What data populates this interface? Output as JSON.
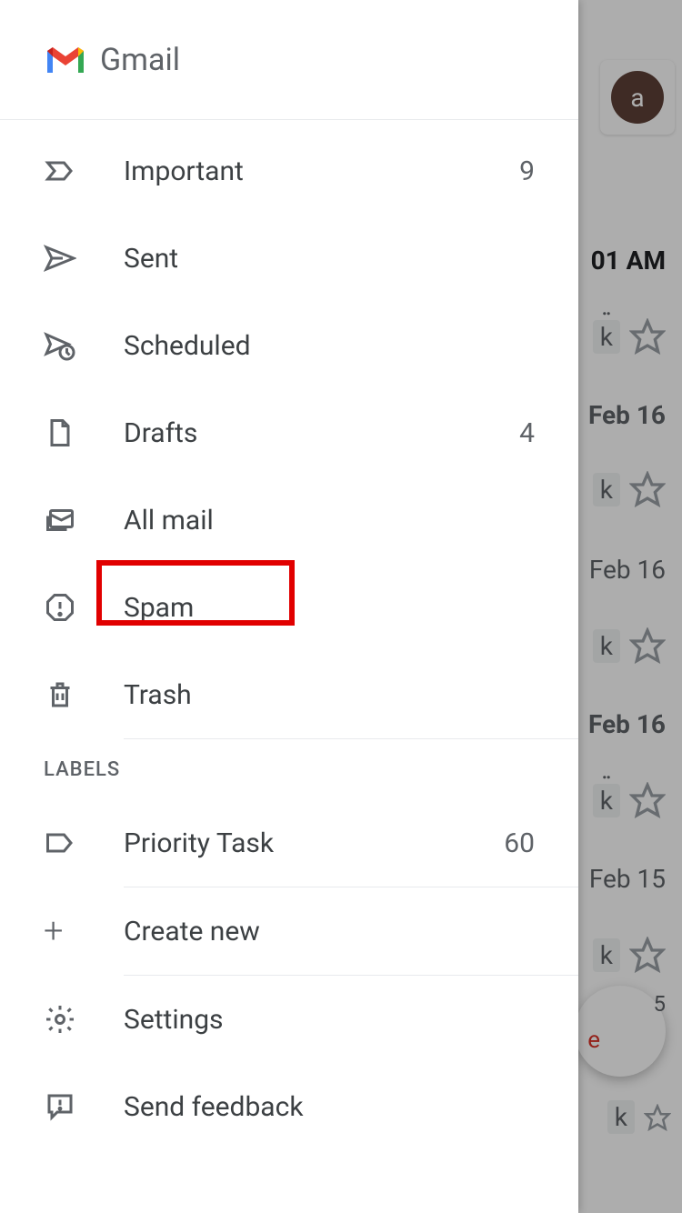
{
  "header": {
    "app_name": "Gmail"
  },
  "nav": {
    "items": [
      {
        "icon": "important",
        "label": "Important",
        "count": "9"
      },
      {
        "icon": "sent",
        "label": "Sent",
        "count": ""
      },
      {
        "icon": "scheduled",
        "label": "Scheduled",
        "count": ""
      },
      {
        "icon": "drafts",
        "label": "Drafts",
        "count": "4"
      },
      {
        "icon": "all-mail",
        "label": "All mail",
        "count": ""
      },
      {
        "icon": "spam",
        "label": "Spam",
        "count": ""
      },
      {
        "icon": "trash",
        "label": "Trash",
        "count": ""
      }
    ],
    "labels_header": "LABELS",
    "labels": [
      {
        "icon": "label",
        "label": "Priority Task",
        "count": "60"
      }
    ],
    "create_new": "Create new",
    "settings": "Settings",
    "send_feedback": "Send feedback"
  },
  "background": {
    "avatar_letter": "a",
    "time1": "01 AM",
    "dots": "..",
    "k": "k",
    "date1": "Feb 16",
    "date2": "Feb 16",
    "date3": "Feb 16",
    "date4": "Feb 15",
    "compose_e": "e",
    "compose_badge": "5"
  }
}
